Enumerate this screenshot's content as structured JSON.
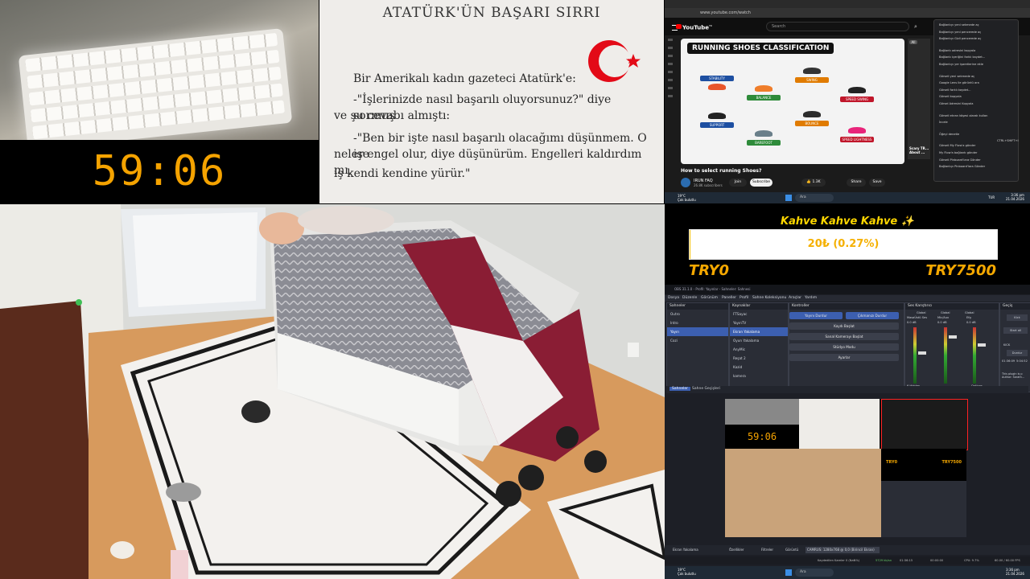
{
  "webcam_timer": "59:06",
  "book": {
    "title": "ATATÜRK'ÜN BAŞARI SIRRI",
    "lines": [
      "Bir Amerikalı kadın gazeteci Atatürk'e:",
      "-\"İşlerinizde nasıl başarılı oluyorsunuz?\" diye sormuş",
      "ve şu cevabı almıştı:",
      "-\"Ben bir işte nasıl başarılı olacağımı düşünmem. O işe",
      "neler engel olur, diye düşünürüm. Engelleri kaldırdım mı,",
      "iş kendi kendine yürür.\""
    ],
    "colors": {
      "flag_red": "#e30a17"
    }
  },
  "browser": {
    "url": "www.youtube.com/watch",
    "site_name": "YouTube",
    "site_badge": "TR",
    "search_placeholder": "Search",
    "video": {
      "thumbnail_title": "RUNNING SHOES CLASSIFICATION",
      "categories": [
        "STABILITY",
        "CUSHION",
        "BALANCE",
        "SWING",
        "SPEED SWING",
        "SUPPORT",
        "BAREFOOT",
        "BOUNCE",
        "SPEED LIGHTNESS"
      ],
      "title": "How to select running Shoes?",
      "channel": "IRUN FAQ",
      "subscribers": "26.8K subscribers",
      "join_label": "Join",
      "subscribe_label": "Subscribe",
      "like_count": "1.3K",
      "share_label": "Share",
      "save_label": "Save"
    },
    "chip_all": "All",
    "side_title": "Scary TR... About ...",
    "context_menu": [
      "Bağlantıyı yeni sekmede aç",
      "Bağlantıyı yeni pencerede aç",
      "Bağlantıyı Gizli pencerede aç",
      "Bağlantı adresini kopyala",
      "Bağlantı içeriğini farklı kaydet...",
      "Bağlantıyı yer işaretlerine ekle",
      "Görseli yeni sekmede aç",
      "Google Lens ile görüntü ara",
      "Görseli farklı kaydet...",
      "Görseli kopyala",
      "Görsel Adresini Kopyala",
      "Görseli ekran köşesi olarak kullan",
      "İncele",
      "Öğeyi denetle",
      "Görseli My Flow'a gönder",
      "My Flow'a bağlantı gönder",
      "Görseli Pinboard'lara Gönder",
      "Bağlantıyı Pinboard'lara Gönder"
    ],
    "context_shortcut": "CTRL+SHIFT+I",
    "taskbar": {
      "weather": "19°C",
      "weather_desc": "Çok bulutlu",
      "search": "Ara",
      "lang": "TUR",
      "time": "3:36 pm",
      "date": "21.04.2026"
    }
  },
  "donation": {
    "title": "Kahve Kahve Kahve ✨",
    "amount_text": "20₺ (0.27%)",
    "progress_fraction": 0.0027,
    "min_label": "TRY0",
    "max_label": "TRY7500"
  },
  "obs": {
    "window_title": "OBS 31.1.0 - Profil: Yayınlar - Sahneler: Sahnesi",
    "menu": [
      "Dosya",
      "Düzenle",
      "Görünüm",
      "Paneller",
      "Profil",
      "Sahne Koleksiyonu",
      "Araçlar",
      "Yardım"
    ],
    "scenes_header": "Sahneler",
    "scenes": [
      "Outro",
      "Intro",
      "Yayın",
      "Cozi"
    ],
    "sources_header": "Kaynaklar",
    "sources": [
      "FTSayac",
      "YayınTV",
      "Ekran Yakalama",
      "Oyun Yakalama",
      "AnyMic",
      "Reşat 2",
      "Kazid",
      "kamera"
    ],
    "controls_header": "Kontroller",
    "controls": [
      "Yayını Durdur",
      "Kaydı Başlat",
      "Sanal Kamerayı Başlat",
      "Stüdyo Modu",
      "Ayarlar"
    ],
    "controls_right": "Çıkmanızı Durdur",
    "mixer_header": "Ses Karıştırıcı",
    "mixer_channels": [
      "Global",
      "Global",
      "Global"
    ],
    "mixer_values": [
      "0.0 dB",
      "0.0 dB",
      "0.0 dB"
    ],
    "mixer_labels": [
      "MasaÜstü Ses",
      "Mic/Aux",
      "Efg"
    ],
    "scene_tabs": [
      "Sahneler",
      "Sahne Geçişleri"
    ],
    "transition_label": "Geçiş",
    "right_labels": [
      "Kick",
      "Durdur",
      "Start all"
    ],
    "kick_label": "KICK",
    "kick_times": [
      "01:36:09",
      "5:04:52"
    ],
    "plugin_note": "This plugin is p Author: Sarath...",
    "options_label": "Options",
    "preview_timer": "59:06",
    "preview_labels": [
      "TRY0",
      "TRY7500"
    ],
    "hidden_count": "6 Hidden",
    "bottom_source": "Ekran Yakalama",
    "bottom_buttons": [
      "Özellikler",
      "Filtreler"
    ],
    "display_label": "Görüntü",
    "display_value": "CAMRUS: 1280x768 @ 0,0 (Birincil Ekran)",
    "status_items": [
      "Kaydedilen Kareler 0 (NaN%)",
      "5729 kb/sn",
      "01:36:15",
      "00:00:00",
      "CPU: 9.7%",
      "60.00 / 60.00 FPS"
    ],
    "taskbar": {
      "weather": "19°C",
      "weather_desc": "Çok bulutlu",
      "search": "Ara",
      "time": "3:36 pm",
      "date": "21.04.2026"
    }
  }
}
